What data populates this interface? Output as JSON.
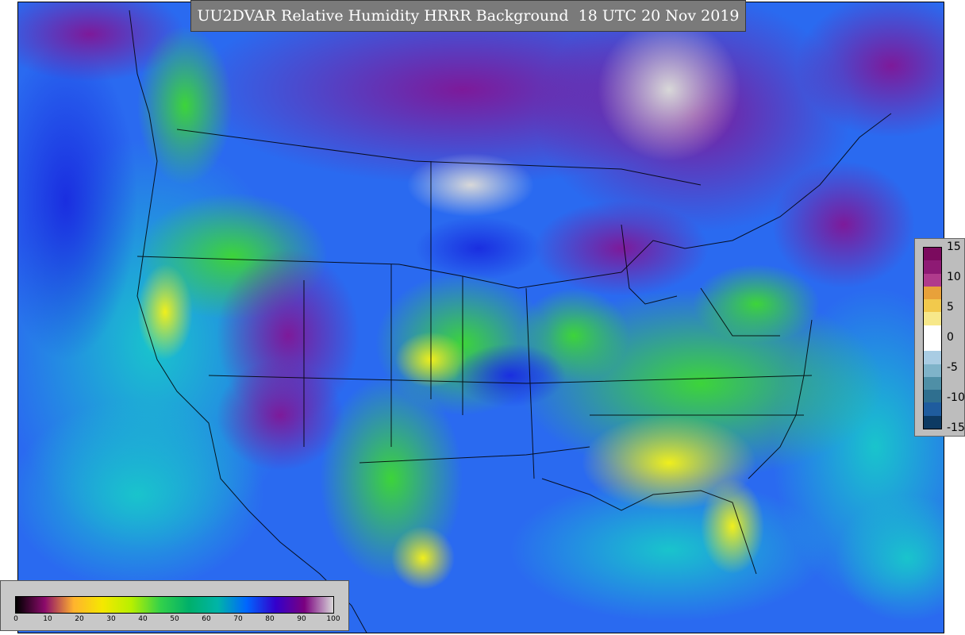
{
  "title": "UU2DVAR Relative Humidity HRRR Background  18 UTC 20 Nov 2019",
  "difference_legend": {
    "ticks": [
      "15",
      "10",
      "5",
      "0",
      "-5",
      "-10",
      "-15"
    ],
    "colors": [
      "#7b0a5e",
      "#8e1a74",
      "#b03b8c",
      "#e8a13a",
      "#f2c94c",
      "#f7e88a",
      "#ffffff",
      "#ffffff",
      "#a9cce3",
      "#7fb3c9",
      "#4f8fa6",
      "#2f6f8f",
      "#1f5c9e",
      "#0d3a63"
    ]
  },
  "humidity_legend": {
    "ticks": [
      "0",
      "10",
      "20",
      "30",
      "40",
      "50",
      "60",
      "70",
      "80",
      "90",
      "100"
    ],
    "colors": [
      "#000000",
      "#8b0a6b",
      "#ffb32e",
      "#f5e800",
      "#b7f000",
      "#33d14a",
      "#00b06a",
      "#00b4a8",
      "#0066ff",
      "#3300cc",
      "#7a007f",
      "#d9d9d9"
    ]
  }
}
